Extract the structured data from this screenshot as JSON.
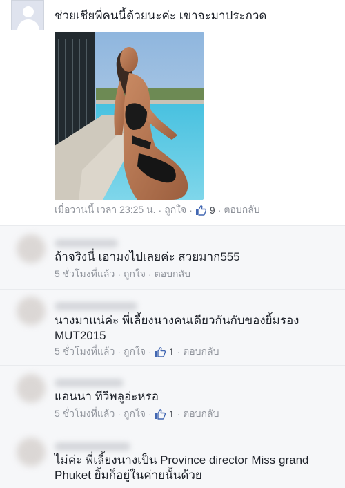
{
  "post": {
    "text": "ช่วยเชียพี่คนนี้ด้วยนะค่ะ เขาจะมาประกวด",
    "time": "เมื่อวานนี้ เวลา 23:25 น.",
    "like_label": "ถูกใจ",
    "like_count": "9",
    "reply_label": "ตอบกลับ"
  },
  "comments": [
    {
      "text": "ถ้าจริงนี่ เอามงไปเลยค่ะ สวยมาก555",
      "time": "5 ชั่วโมงที่แล้ว",
      "like_label": "ถูกใจ",
      "reply_label": "ตอบกลับ"
    },
    {
      "text": "นางมาแน่ค่ะ พี่เลี้ยงนางคนเดียวกันกับของยิ้มรอง MUT2015",
      "time": "5 ชั่วโมงที่แล้ว",
      "like_label": "ถูกใจ",
      "like_count": "1",
      "reply_label": "ตอบกลับ"
    },
    {
      "text": "แอนนา ทีวีพลูอ่ะหรอ",
      "time": "5 ชั่วโมงที่แล้ว",
      "like_label": "ถูกใจ",
      "like_count": "1",
      "reply_label": "ตอบกลับ"
    },
    {
      "text": "ไม่ค่ะ พี่เลี้ยงนางเป็น Province director Miss grand Phuket ยิ้มก็อยู่ในค่ายนั้นด้วย"
    }
  ],
  "colors": {
    "text": "#1d2129",
    "meta": "#90949c",
    "like_blue": "#4267b2",
    "comment_bg": "#f6f7f9",
    "divider": "#e9ebee"
  },
  "icons": {
    "default_avatar": "default-profile-icon",
    "like": "thumbs-up-icon"
  }
}
